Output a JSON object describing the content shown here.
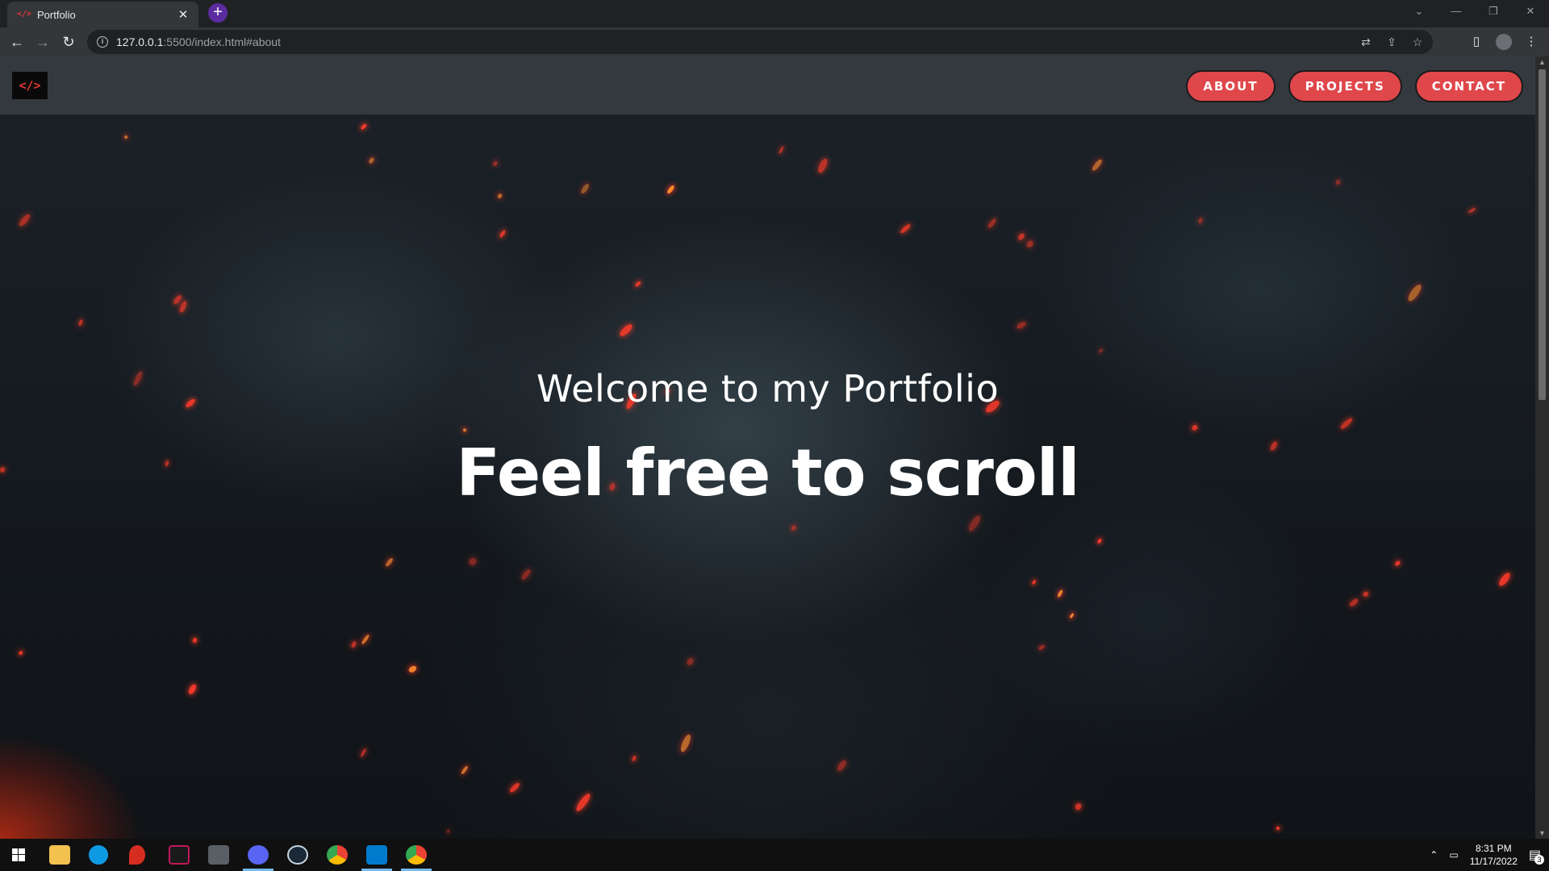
{
  "browser": {
    "tab_title": "Portfolio",
    "tab_favicon": "</>",
    "url_host": "127.0.0.1",
    "url_rest": ":5500/index.html#about"
  },
  "page": {
    "logo": "</>",
    "nav": [
      "ABOUT",
      "PROJECTS",
      "CONTACT"
    ],
    "hero_subtitle": "Welcome to my Portfolio",
    "hero_title": "Feel free to scroll"
  },
  "taskbar": {
    "time": "8:31 PM",
    "date": "11/17/2022",
    "notifications": "3"
  },
  "colors": {
    "accent": "#e0474b",
    "header_bg": "#34393f",
    "logo_red": "#e53935"
  }
}
